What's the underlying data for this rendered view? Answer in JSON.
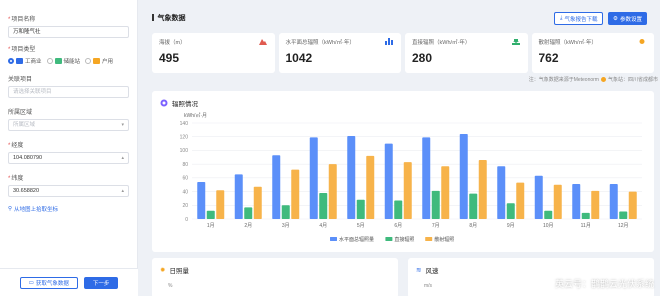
{
  "form": {
    "project_name": {
      "label": "项目名称",
      "value": "万和隆气社"
    },
    "project_type": {
      "label": "项目类型",
      "options": [
        {
          "label": "工商业",
          "selected": true
        },
        {
          "label": "储能站",
          "selected": false
        },
        {
          "label": "户用",
          "selected": false
        }
      ]
    },
    "related_project": {
      "label": "关联项目",
      "placeholder": "请选择关联项目"
    },
    "region": {
      "label": "所属区域",
      "placeholder": "所属区域"
    },
    "longitude": {
      "label": "经度",
      "value": "104.080790"
    },
    "latitude": {
      "label": "纬度",
      "value": "30.658820"
    },
    "map_link": "从地图上拾取坐标",
    "fetch_button": "获取气象数据",
    "next_button": "下一步"
  },
  "header": {
    "title": "气象数据",
    "download_button": "气象报告下载",
    "params_button": "参数设置"
  },
  "cards": [
    {
      "label": "海拔（m）",
      "value": "495",
      "icon": "mountain-icon",
      "color": "#e05a4f"
    },
    {
      "label": "水平面总辐照（kWh/㎡·年）",
      "value": "1042",
      "icon": "bar-chart-icon",
      "color": "#2e6be6"
    },
    {
      "label": "直接辐照（kWh/㎡·年）",
      "value": "280",
      "icon": "download-icon",
      "color": "#2fae6c"
    },
    {
      "label": "散射辐照（kWh/㎡·年）",
      "value": "762",
      "icon": "sun-icon",
      "color": "#f5a623"
    }
  ],
  "note": {
    "source": "注：气象数据来源于Meteonorm",
    "legend": "气象站：四川省成都市"
  },
  "chart_panel_title": "辐照情况",
  "chart_data": {
    "type": "bar",
    "ylabel": "kWh/㎡·月",
    "ylim": [
      0,
      140
    ],
    "yticks": [
      0,
      20,
      40,
      60,
      80,
      100,
      120,
      140
    ],
    "categories": [
      "1月",
      "2月",
      "3月",
      "4月",
      "5月",
      "6月",
      "7月",
      "8月",
      "9月",
      "10月",
      "11月",
      "12月"
    ],
    "series": [
      {
        "name": "水平面总辐照量",
        "color": "#5b8ff9",
        "values": [
          54,
          65,
          93,
          119,
          121,
          110,
          119,
          124,
          77,
          63,
          51,
          51
        ]
      },
      {
        "name": "直接辐照",
        "color": "#3fba7d",
        "values": [
          12,
          17,
          20,
          38,
          28,
          27,
          41,
          37,
          23,
          12,
          9,
          11
        ]
      },
      {
        "name": "散射辐照",
        "color": "#f7b34a",
        "values": [
          42,
          47,
          72,
          80,
          92,
          83,
          77,
          86,
          53,
          50,
          41,
          40
        ]
      }
    ]
  },
  "sunshine_panel": {
    "title": "日照量",
    "unit": "%"
  },
  "wind_panel": {
    "title": "风速",
    "unit": "m/s"
  },
  "watermark": "英云号：鹊鹊云光伏系统"
}
